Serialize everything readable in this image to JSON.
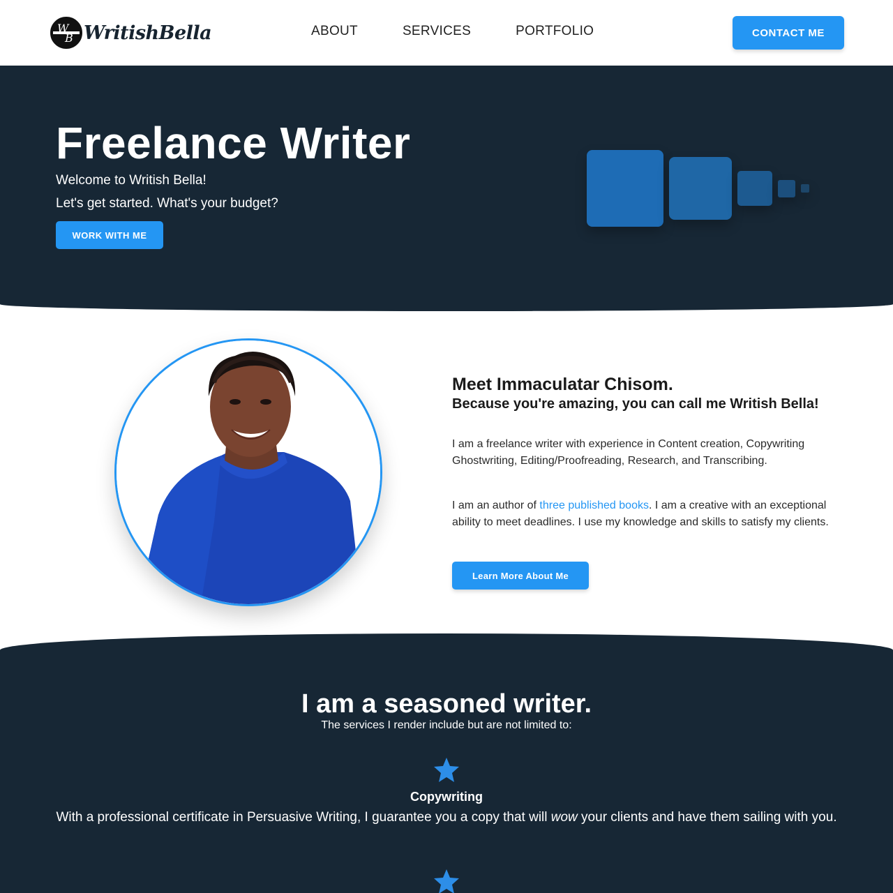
{
  "nav": {
    "logo_text": "WritishBella",
    "logo_monogram": "WB",
    "links": [
      "ABOUT",
      "SERVICES",
      "PORTFOLIO"
    ],
    "contact_label": "CONTACT ME"
  },
  "hero": {
    "title": "Freelance Writer",
    "line1": "Welcome to Writish Bella!",
    "line2": "Let's get started. What's your budget?",
    "cta_label": "WORK WITH ME"
  },
  "about": {
    "title": "Meet Immaculatar Chisom.",
    "subtitle": "Because you're amazing, you can call me Writish Bella!",
    "p1": "I am a freelance writer with experience in Content creation, Copywriting Ghostwriting, Editing/Proofreading, Research, and Transcribing.",
    "p2_before": "I am an author of ",
    "p2_link": "three published books",
    "p2_after": ". I am a creative with an exceptional ability to meet deadlines. I use my knowledge and skills to satisfy my clients.",
    "cta_label": "Learn More About Me"
  },
  "services": {
    "title": "I am a seasoned writer.",
    "subtitle": "The services I render include but are not limited to:",
    "items": [
      {
        "icon": "star-icon",
        "title": "Copywriting",
        "desc_before": "With a professional certificate in Persuasive Writing, I guarantee you a copy that will ",
        "desc_em": "wow",
        "desc_after": " your clients and have them sailing with you."
      }
    ]
  },
  "colors": {
    "accent": "#2496f3",
    "dark": "#172735",
    "square_blue": "#1e6cb5"
  }
}
